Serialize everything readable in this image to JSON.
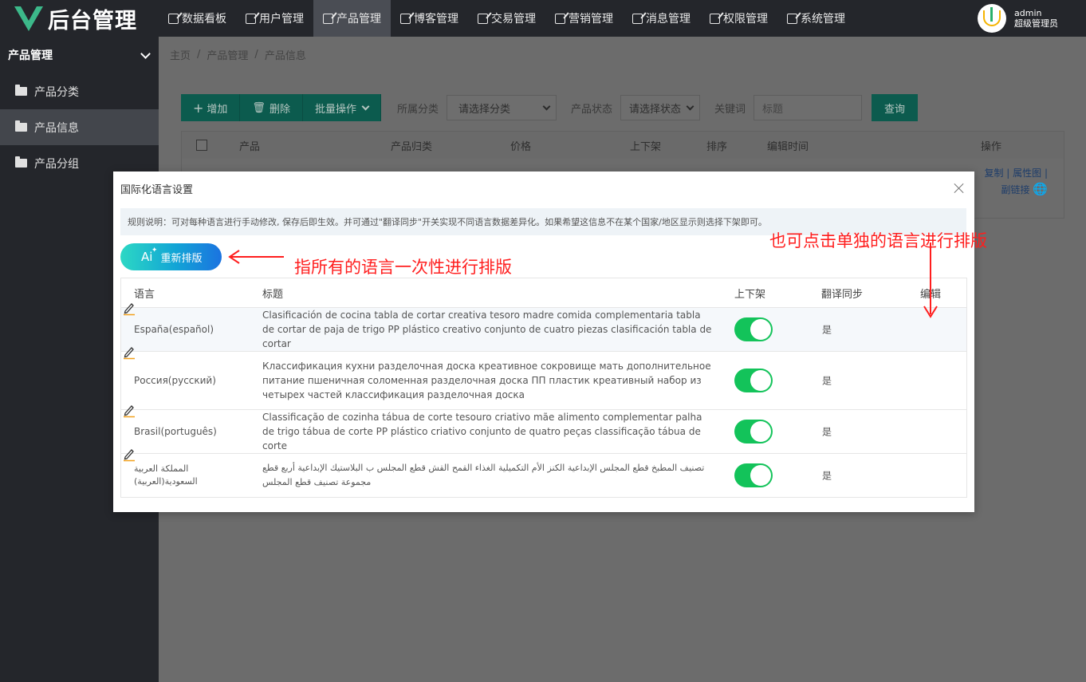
{
  "app": {
    "title": "后台管理"
  },
  "nav": [
    {
      "label": "数据看板",
      "active": false
    },
    {
      "label": "用户管理",
      "active": false
    },
    {
      "label": "产品管理",
      "active": true
    },
    {
      "label": "博客管理",
      "active": false
    },
    {
      "label": "交易管理",
      "active": false
    },
    {
      "label": "营销管理",
      "active": false
    },
    {
      "label": "消息管理",
      "active": false
    },
    {
      "label": "权限管理",
      "active": false
    },
    {
      "label": "系统管理",
      "active": false
    }
  ],
  "user": {
    "name": "admin",
    "role": "超级管理员"
  },
  "sidebar": {
    "header": "产品管理",
    "items": [
      {
        "label": "产品分类",
        "active": false
      },
      {
        "label": "产品信息",
        "active": true
      },
      {
        "label": "产品分组",
        "active": false
      }
    ]
  },
  "breadcrumb": [
    "主页",
    "/",
    "产品管理",
    "/",
    "产品信息"
  ],
  "toolbar": {
    "add_label": "增加",
    "delete_label": "删除",
    "batch_label": "批量操作",
    "category_label": "所属分类",
    "category_value": "请选择分类",
    "status_label": "产品状态",
    "status_value": "请选择状态",
    "keyword_label": "关键词",
    "keyword_placeholder": "标题",
    "query_label": "查询"
  },
  "product_table": {
    "columns": [
      "产品",
      "产品归类",
      "价格",
      "上下架",
      "排序",
      "编辑时间",
      "操作"
    ],
    "row_actions": [
      "复制",
      "属性图",
      "副链接"
    ]
  },
  "modal": {
    "title": "国际化语言设置",
    "notice": "规则说明：可对每种语言进行手动修改, 保存后即生效。并可通过\"翻译同步\"开关实现不同语言数据差异化。如果希望这信息不在某个国家/地区显示则选择下架即可。",
    "ai_button": "重新排版",
    "columns": [
      "语言",
      "标题",
      "上下架",
      "翻译同步",
      "编辑"
    ],
    "rows": [
      {
        "lang": "España(español)",
        "title": "Clasificación de cocina tabla de cortar creativa tesoro madre comida complementaria tabla de cortar de paja de trigo PP plástico creativo conjunto de cuatro piezas clasificación tabla de cortar",
        "on_shelf": true,
        "sync": "是"
      },
      {
        "lang": "Россия(русский)",
        "title": "Классификация кухни разделочная доска креативное сокровище мать дополнительное питание пшеничная соломенная разделочная доска ПП пластик креативный набор из четырех частей классификация разделочная доска",
        "on_shelf": true,
        "sync": "是"
      },
      {
        "lang": "Brasil(português)",
        "title": "Classificação de cozinha tábua de corte tesouro criativo mãe alimento complementar palha de trigo tábua de corte PP plástico criativo conjunto de quatro peças classificação tábua de corte",
        "on_shelf": true,
        "sync": "是"
      },
      {
        "lang": "المملكة العربية السعودية(العربية)",
        "title": "تصنيف المطبخ قطع المجلس الإبداعية الكنز الأم التكميلية الغذاء القمح القش قطع المجلس ب البلاستيك الإبداعية أربع قطع مجموعة تصنيف قطع المجلس",
        "on_shelf": true,
        "sync": "是"
      }
    ]
  },
  "annotations": {
    "left": "指所有的语言一次性进行排版",
    "right": "也可点击单独的语言进行排版",
    "color": "#ff1e1e"
  }
}
